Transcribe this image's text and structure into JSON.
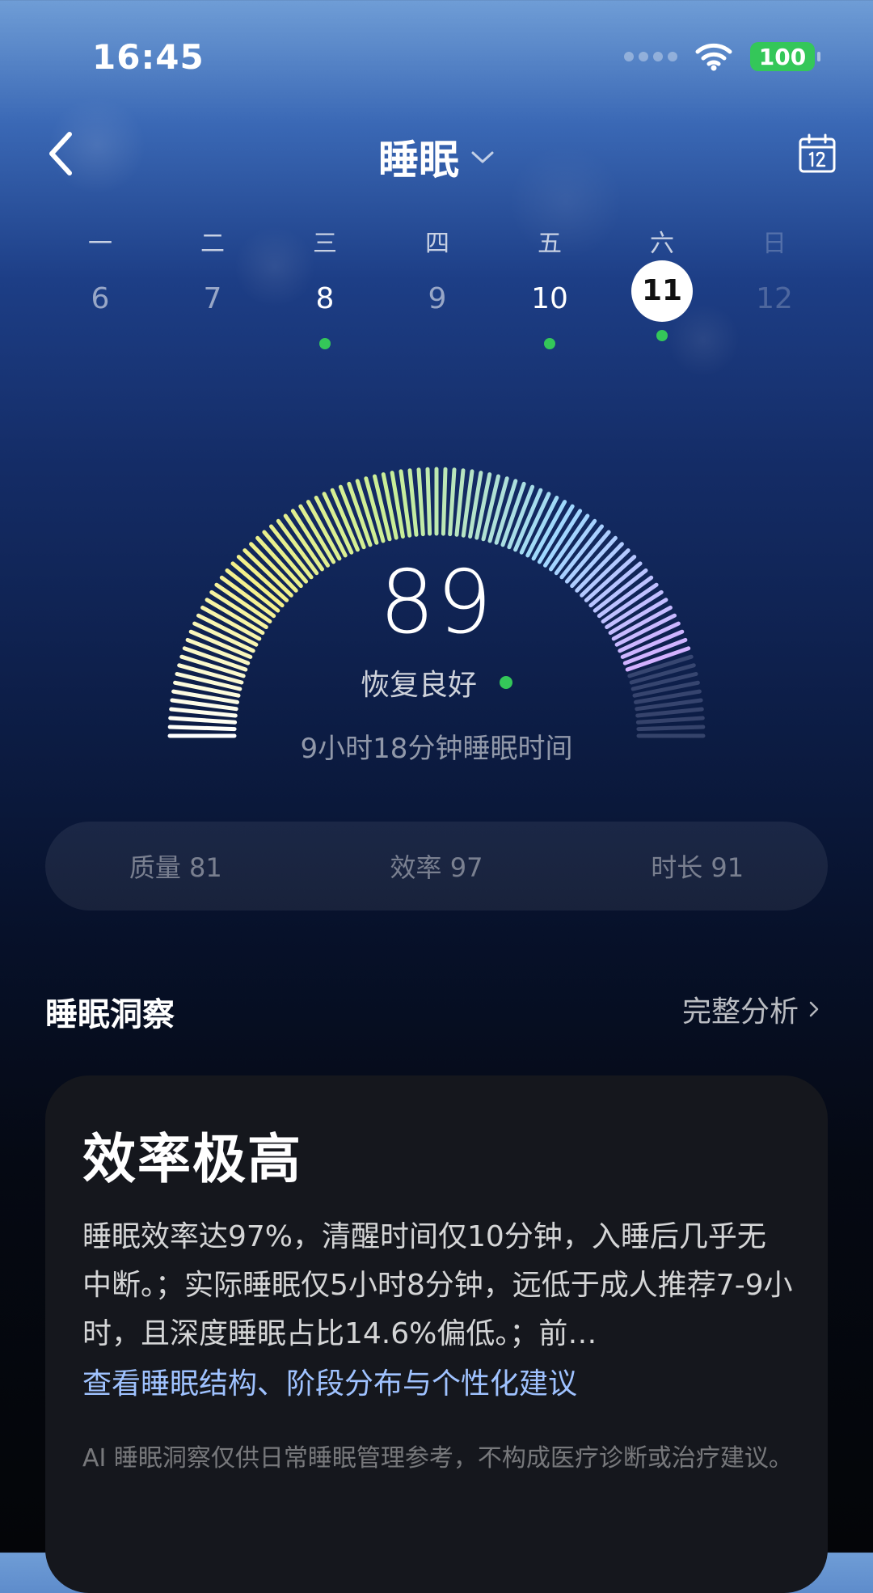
{
  "status_bar": {
    "time": "16:45",
    "battery": "100"
  },
  "header": {
    "title": "睡眠"
  },
  "week": [
    {
      "name": "一",
      "num": "6",
      "state": "normal",
      "has_data": false
    },
    {
      "name": "二",
      "num": "7",
      "state": "normal",
      "has_data": false
    },
    {
      "name": "三",
      "num": "8",
      "state": "active",
      "has_data": true
    },
    {
      "name": "四",
      "num": "9",
      "state": "normal",
      "has_data": false
    },
    {
      "name": "五",
      "num": "10",
      "state": "active",
      "has_data": true
    },
    {
      "name": "六",
      "num": "11",
      "state": "selected",
      "has_data": true
    },
    {
      "name": "日",
      "num": "12",
      "state": "muted",
      "has_data": false
    }
  ],
  "score": {
    "value": "89",
    "fraction": 0.89,
    "status": "恢复良好",
    "duration": "9小时18分钟睡眠时间",
    "colors": [
      "#ffffff",
      "#f4f08a",
      "#c8ee98",
      "#9fd8ff",
      "#d2b2ff"
    ]
  },
  "metrics": [
    {
      "label": "质量 81"
    },
    {
      "label": "效率 97"
    },
    {
      "label": "时长 91"
    }
  ],
  "insights": {
    "title": "睡眠洞察",
    "link": "完整分析",
    "card_title": "效率极高",
    "card_body": "睡眠效率达97%，清醒时间仅10分钟，入睡后几乎无中断。；实际睡眠仅5小时8分钟，远低于成人推荐7-9小时，且深度睡眠占比14.6%偏低。；前…",
    "card_link": "查看睡眠结构、阶段分布与个性化建议",
    "disclaimer": "AI 睡眠洞察仅供日常睡眠管理参考，不构成医疗诊断或治疗建议。"
  },
  "icons": {
    "back": "chevron-left-icon",
    "title_dropdown": "chevron-down-icon",
    "calendar": "calendar-icon",
    "wifi": "wifi-icon",
    "link": "chevron-right-icon"
  },
  "colors": {
    "accent_green": "#34c759",
    "link_blue": "#9fc2ff"
  }
}
